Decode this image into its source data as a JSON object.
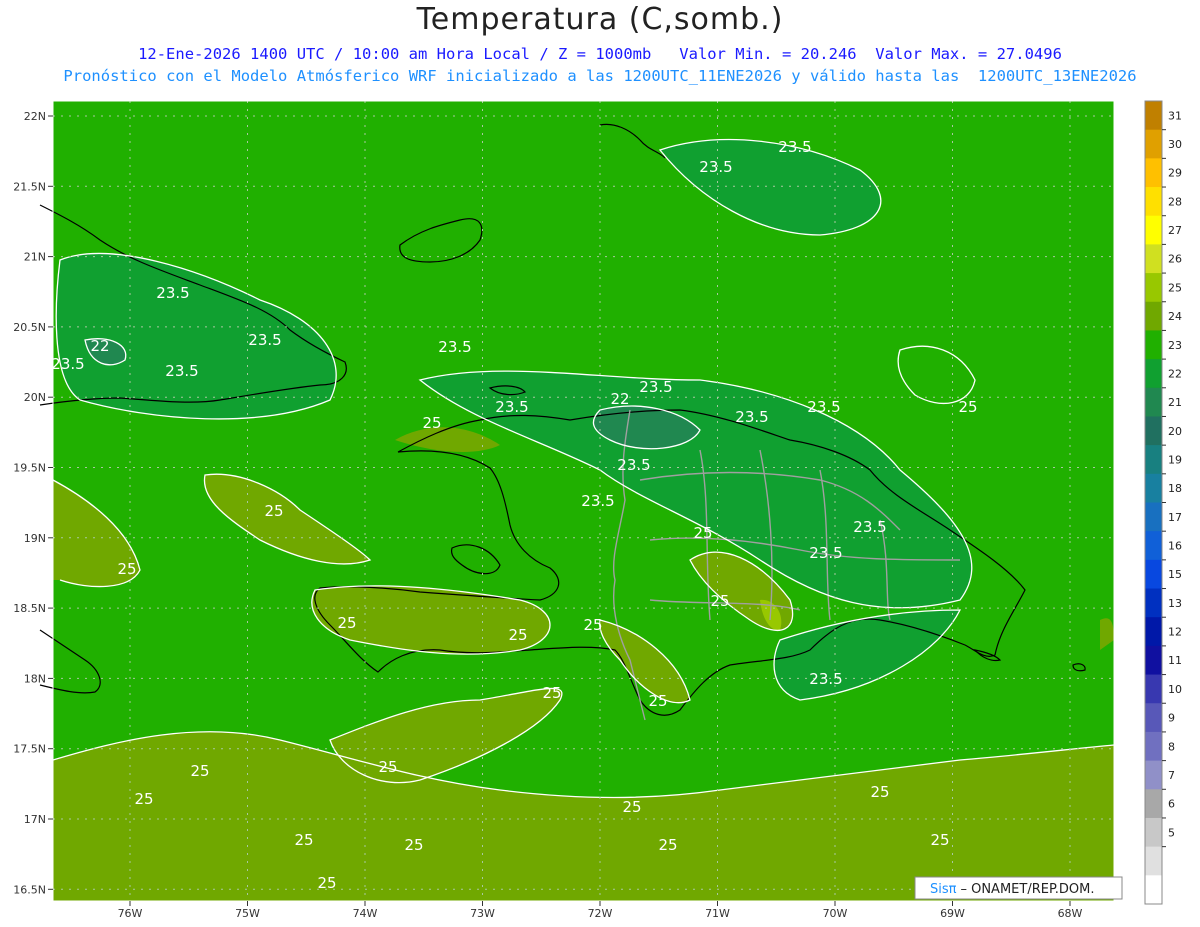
{
  "title": "Temperatura (C,somb.)",
  "subtitle": "12-Ene-2026 1400 UTC / 10:00 am Hora Local / Z = 1000mb   Valor Min. = 20.246  Valor Max. = 27.0496",
  "subtitle2": "Pronóstico con el Modelo Atmósferico WRF inicializado a las 1200UTC_11ENE2026 y válido hasta las  1200UTC_13ENE2026",
  "lat_labels": [
    "22N",
    "21.5N",
    "21N",
    "20.5N",
    "20N",
    "19.5N",
    "19N",
    "18.5N",
    "18N",
    "17.5N",
    "17N",
    "16.5N"
  ],
  "lon_labels": [
    "76W",
    "75W",
    "74W",
    "73W",
    "72W",
    "71W",
    "70W",
    "69W",
    "68W"
  ],
  "colorbar": {
    "labels": [
      "31",
      "30",
      "29",
      "28",
      "27",
      "26",
      "25",
      "24",
      "23",
      "22",
      "21",
      "20",
      "19",
      "18",
      "17",
      "16",
      "15",
      "13",
      "12",
      "11",
      "10",
      "9",
      "8",
      "7",
      "6",
      "5"
    ],
    "colors": [
      "#c08000",
      "#e0a000",
      "#ffc000",
      "#ffe000",
      "#ffff00",
      "#d0e020",
      "#98c800",
      "#70a800",
      "#20b000",
      "#10a030",
      "#208850",
      "#207060",
      "#188080",
      "#1880a0",
      "#1870c0",
      "#1060d8",
      "#0848e0",
      "#0030c0",
      "#0018a8",
      "#1010a0",
      "#3838b0",
      "#5858b8",
      "#7070c0",
      "#9090c8",
      "#a8a8a8",
      "#c8c8c8",
      "#e0e0e0",
      "#ffffff"
    ]
  },
  "contour_labels": [
    "23.5",
    "23.5",
    "23.5",
    "23.5",
    "22",
    "23.5",
    "23.5",
    "23.5",
    "22",
    "23.5",
    "23.5",
    "23.5",
    "23.5",
    "23.5",
    "23.5",
    "23.5",
    "23.5",
    "23.5",
    "25",
    "25",
    "25",
    "25",
    "25",
    "25",
    "25",
    "25",
    "25",
    "25",
    "25",
    "25",
    "25",
    "25",
    "25",
    "25",
    "25",
    "25",
    "25",
    "25",
    "25"
  ],
  "credit": {
    "brand": "Sisπ",
    "text": "– ONAMET/REP.DOM."
  }
}
